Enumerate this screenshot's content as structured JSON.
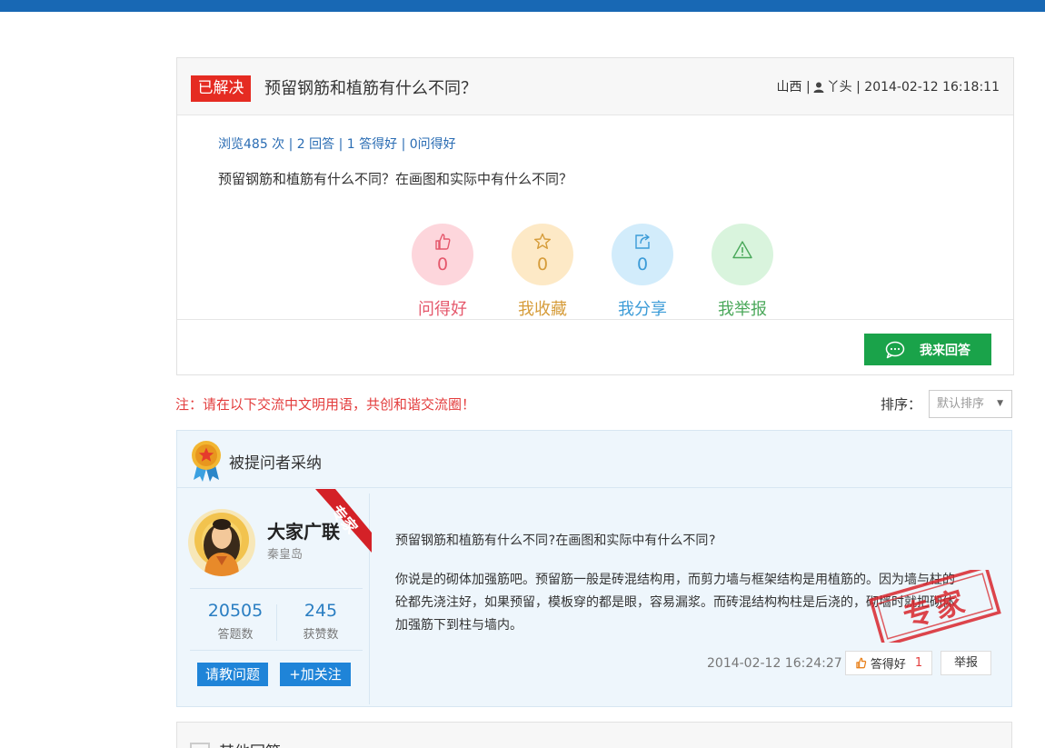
{
  "question": {
    "status_badge": "已解决",
    "title": "预留钢筋和植筋有什么不同？",
    "meta_region": "山西 |",
    "meta_user": "丫头 | 2014-02-12 16:18:11",
    "stats": "浏览485 次 | 2 回答 | 1 答得好 | 0问得好",
    "body": "预留钢筋和植筋有什么不同？在画图和实际中有什么不同？"
  },
  "actions": [
    {
      "count": "0",
      "label": "问得好",
      "icon": "thumbs-up-icon",
      "color": "#e5586c"
    },
    {
      "count": "0",
      "label": "我收藏",
      "icon": "star-icon",
      "color": "#d69c3a"
    },
    {
      "count": "0",
      "label": "我分享",
      "icon": "share-icon",
      "color": "#3b9bd7"
    },
    {
      "count": "0",
      "label": "我举报",
      "icon": "warning-icon",
      "color": "#4aa85a"
    }
  ],
  "answer_button": "我来回答",
  "notice": "注：请在以下交流中文明用语，共创和谐交流圈！",
  "sort": {
    "label": "排序：",
    "selected": "默认排序"
  },
  "accepted": {
    "header": "被提问者采纳",
    "user": {
      "name": "大家广联",
      "location": "秦皇岛",
      "ribbon": "专家",
      "answers_count": "20505",
      "answers_label": "答题数",
      "likes_count": "245",
      "likes_label": "获赞数",
      "ask_button": "请教问题",
      "follow_button": "+加关注"
    },
    "question_text": "预留钢筋和植筋有什么不同?在画图和实际中有什么不同?",
    "answer_text": "你说是的砌体加强筋吧。预留筋一般是砖混结构用，而剪力墙与框架结构是用植筋的。因为墙与柱的砼都先浇注好，如果预留，模板穿的都是眼，容易漏浆。而砖混结构构柱是后浇的，砌墙时就把砌体加强筋下到柱与墙内。",
    "stamp": "专家",
    "date": "2014-02-12 16:24:27",
    "like_label": "答得好",
    "like_count": "1",
    "report_label": "举报"
  },
  "other_answers": {
    "title": "其他回答"
  },
  "colors": {
    "topbar": "#1868b4",
    "badge_red": "#e52b22",
    "answer_green": "#1aa34a",
    "link_blue": "#2a6cb3"
  }
}
